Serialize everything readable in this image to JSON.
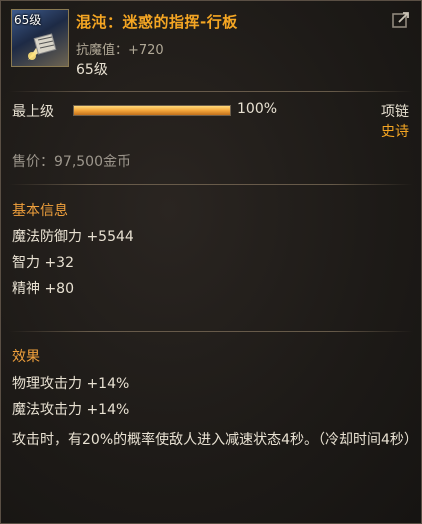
{
  "item": {
    "icon_level": "65级",
    "name": "混沌：迷惑的指挥-行板",
    "resist_stat": "抗魔值：+720",
    "level": "65级",
    "icon": "conductor-baton-icon"
  },
  "quality": {
    "label": "最上级",
    "percent_text": "100%",
    "fill_fraction": 1.0
  },
  "slot": "项链",
  "rarity": "史诗",
  "price": "售价：97,500金币",
  "basic_info": {
    "title": "基本信息",
    "lines": [
      "魔法防御力 +5544",
      "智力 +32",
      "精神 +80"
    ]
  },
  "effects": {
    "title": "效果",
    "lines": [
      "物理攻击力 +14%",
      "魔法攻击力 +14%"
    ],
    "description": "攻击时，有20%的概率使敌人进入减速状态4秒。（冷却时间4秒）"
  },
  "colors": {
    "title_orange": "#f5a623",
    "section_orange": "#f0a03c",
    "text_light": "#e8e1d2",
    "text_muted": "#9c968c"
  }
}
